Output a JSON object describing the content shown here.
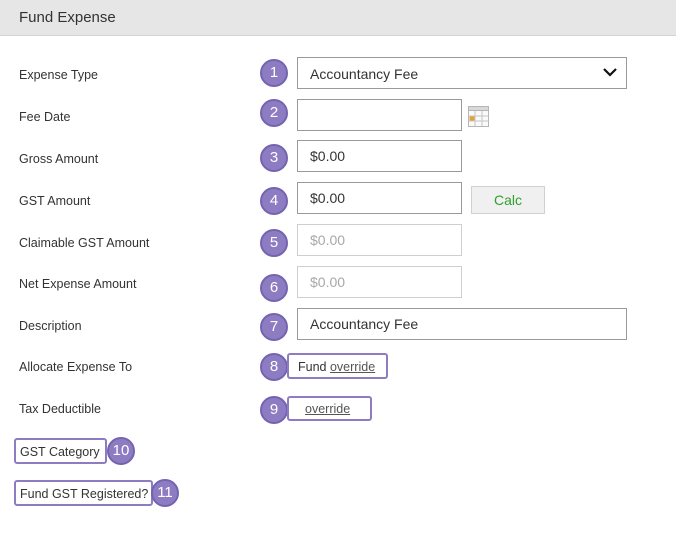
{
  "header": {
    "title": "Fund Expense"
  },
  "fields": {
    "expense_type": {
      "label": "Expense Type",
      "value": "Accountancy Fee",
      "step": "1"
    },
    "fee_date": {
      "label": "Fee Date",
      "value": "",
      "step": "2"
    },
    "gross_amount": {
      "label": "Gross Amount",
      "value": "$0.00",
      "step": "3"
    },
    "gst_amount": {
      "label": "GST Amount",
      "value": "$0.00",
      "step": "4",
      "calc_label": "Calc"
    },
    "claimable_gst_amount": {
      "label": "Claimable GST Amount",
      "value": "$0.00",
      "step": "5"
    },
    "net_expense_amount": {
      "label": "Net Expense Amount",
      "value": "$0.00",
      "step": "6"
    },
    "description": {
      "label": "Description",
      "value": "Accountancy Fee",
      "step": "7"
    },
    "allocate_expense_to": {
      "label": "Allocate Expense To",
      "value": "Fund",
      "link": "override",
      "step": "8"
    },
    "tax_deductible": {
      "label": "Tax Deductible",
      "link": "override",
      "step": "9"
    },
    "gst_category": {
      "label": "GST Category",
      "step": "10"
    },
    "fund_gst_registered": {
      "label": "Fund GST Registered?",
      "step": "11"
    }
  },
  "icons": {
    "dropdown": "chevron-down-icon",
    "calendar": "calendar-icon"
  },
  "colors": {
    "badge": "#8e7cc3",
    "calc_text": "#2ea02e",
    "header_bg": "#e6e6e6"
  }
}
